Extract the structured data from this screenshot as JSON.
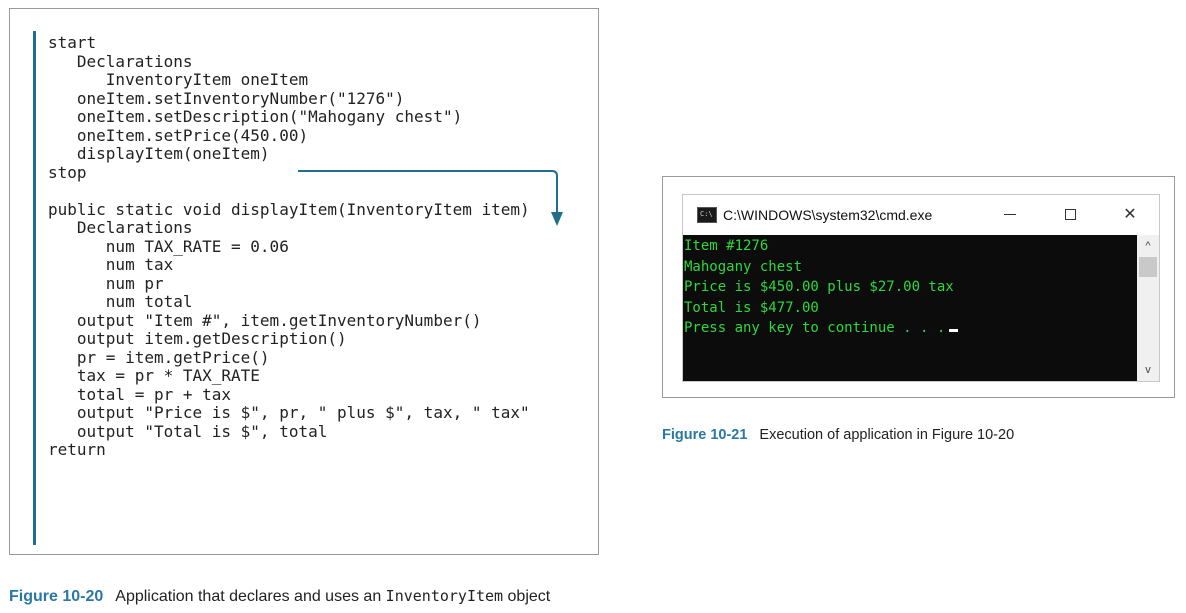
{
  "code_listing": {
    "lines": [
      "start",
      "   Declarations",
      "      InventoryItem oneItem",
      "   oneItem.setInventoryNumber(\"1276\")",
      "   oneItem.setDescription(\"Mahogany chest\")",
      "   oneItem.setPrice(450.00)",
      "   displayItem(oneItem)",
      "stop",
      "",
      "public static void displayItem(InventoryItem item)",
      "   Declarations",
      "      num TAX_RATE = 0.06",
      "      num tax",
      "      num pr",
      "      num total",
      "   output \"Item #\", item.getInventoryNumber()",
      "   output item.getDescription()",
      "   pr = item.getPrice()",
      "   tax = pr * TAX_RATE",
      "   total = pr + tax",
      "   output \"Price is $\", pr, \" plus $\", tax, \" tax\"",
      "   output \"Total is $\", total",
      "return"
    ],
    "accent_color": "#1f6f8b"
  },
  "console_window": {
    "title": "C:\\WINDOWS\\system32\\cmd.exe",
    "icon": "cmd-icon",
    "icon_text": "C:\\",
    "controls": {
      "minimize": "minimize-icon",
      "maximize": "maximize-icon",
      "close_glyph": "✕"
    },
    "output_lines": [
      "Item #1276",
      "Mahogany chest",
      "Price is $450.00 plus $27.00 tax",
      "Total is $477.00",
      "Press any key to continue . . ."
    ],
    "text_color": "#2bd93a",
    "background_color": "#0c0c0c",
    "scroll_up_glyph": "^",
    "scroll_down_glyph": "v"
  },
  "captions": {
    "fig_10_21": {
      "label": "Figure 10-21",
      "text": "Execution of application in Figure 10-20"
    },
    "fig_10_20": {
      "label": "Figure 10-20",
      "text_before": "Application that declares and uses an ",
      "code_term": "InventoryItem",
      "text_after": " object"
    },
    "label_color": "#2a78a4"
  }
}
